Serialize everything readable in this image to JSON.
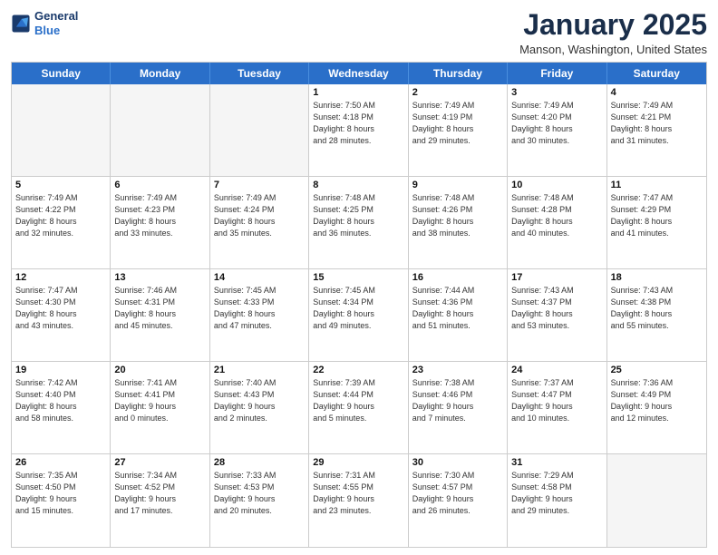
{
  "header": {
    "logo_line1": "General",
    "logo_line2": "Blue",
    "month_title": "January 2025",
    "location": "Manson, Washington, United States"
  },
  "weekdays": [
    "Sunday",
    "Monday",
    "Tuesday",
    "Wednesday",
    "Thursday",
    "Friday",
    "Saturday"
  ],
  "weeks": [
    [
      {
        "day": "",
        "info": "",
        "empty": true
      },
      {
        "day": "",
        "info": "",
        "empty": true
      },
      {
        "day": "",
        "info": "",
        "empty": true
      },
      {
        "day": "1",
        "info": "Sunrise: 7:50 AM\nSunset: 4:18 PM\nDaylight: 8 hours\nand 28 minutes.",
        "empty": false
      },
      {
        "day": "2",
        "info": "Sunrise: 7:49 AM\nSunset: 4:19 PM\nDaylight: 8 hours\nand 29 minutes.",
        "empty": false
      },
      {
        "day": "3",
        "info": "Sunrise: 7:49 AM\nSunset: 4:20 PM\nDaylight: 8 hours\nand 30 minutes.",
        "empty": false
      },
      {
        "day": "4",
        "info": "Sunrise: 7:49 AM\nSunset: 4:21 PM\nDaylight: 8 hours\nand 31 minutes.",
        "empty": false
      }
    ],
    [
      {
        "day": "5",
        "info": "Sunrise: 7:49 AM\nSunset: 4:22 PM\nDaylight: 8 hours\nand 32 minutes.",
        "empty": false
      },
      {
        "day": "6",
        "info": "Sunrise: 7:49 AM\nSunset: 4:23 PM\nDaylight: 8 hours\nand 33 minutes.",
        "empty": false
      },
      {
        "day": "7",
        "info": "Sunrise: 7:49 AM\nSunset: 4:24 PM\nDaylight: 8 hours\nand 35 minutes.",
        "empty": false
      },
      {
        "day": "8",
        "info": "Sunrise: 7:48 AM\nSunset: 4:25 PM\nDaylight: 8 hours\nand 36 minutes.",
        "empty": false
      },
      {
        "day": "9",
        "info": "Sunrise: 7:48 AM\nSunset: 4:26 PM\nDaylight: 8 hours\nand 38 minutes.",
        "empty": false
      },
      {
        "day": "10",
        "info": "Sunrise: 7:48 AM\nSunset: 4:28 PM\nDaylight: 8 hours\nand 40 minutes.",
        "empty": false
      },
      {
        "day": "11",
        "info": "Sunrise: 7:47 AM\nSunset: 4:29 PM\nDaylight: 8 hours\nand 41 minutes.",
        "empty": false
      }
    ],
    [
      {
        "day": "12",
        "info": "Sunrise: 7:47 AM\nSunset: 4:30 PM\nDaylight: 8 hours\nand 43 minutes.",
        "empty": false
      },
      {
        "day": "13",
        "info": "Sunrise: 7:46 AM\nSunset: 4:31 PM\nDaylight: 8 hours\nand 45 minutes.",
        "empty": false
      },
      {
        "day": "14",
        "info": "Sunrise: 7:45 AM\nSunset: 4:33 PM\nDaylight: 8 hours\nand 47 minutes.",
        "empty": false
      },
      {
        "day": "15",
        "info": "Sunrise: 7:45 AM\nSunset: 4:34 PM\nDaylight: 8 hours\nand 49 minutes.",
        "empty": false
      },
      {
        "day": "16",
        "info": "Sunrise: 7:44 AM\nSunset: 4:36 PM\nDaylight: 8 hours\nand 51 minutes.",
        "empty": false
      },
      {
        "day": "17",
        "info": "Sunrise: 7:43 AM\nSunset: 4:37 PM\nDaylight: 8 hours\nand 53 minutes.",
        "empty": false
      },
      {
        "day": "18",
        "info": "Sunrise: 7:43 AM\nSunset: 4:38 PM\nDaylight: 8 hours\nand 55 minutes.",
        "empty": false
      }
    ],
    [
      {
        "day": "19",
        "info": "Sunrise: 7:42 AM\nSunset: 4:40 PM\nDaylight: 8 hours\nand 58 minutes.",
        "empty": false
      },
      {
        "day": "20",
        "info": "Sunrise: 7:41 AM\nSunset: 4:41 PM\nDaylight: 9 hours\nand 0 minutes.",
        "empty": false
      },
      {
        "day": "21",
        "info": "Sunrise: 7:40 AM\nSunset: 4:43 PM\nDaylight: 9 hours\nand 2 minutes.",
        "empty": false
      },
      {
        "day": "22",
        "info": "Sunrise: 7:39 AM\nSunset: 4:44 PM\nDaylight: 9 hours\nand 5 minutes.",
        "empty": false
      },
      {
        "day": "23",
        "info": "Sunrise: 7:38 AM\nSunset: 4:46 PM\nDaylight: 9 hours\nand 7 minutes.",
        "empty": false
      },
      {
        "day": "24",
        "info": "Sunrise: 7:37 AM\nSunset: 4:47 PM\nDaylight: 9 hours\nand 10 minutes.",
        "empty": false
      },
      {
        "day": "25",
        "info": "Sunrise: 7:36 AM\nSunset: 4:49 PM\nDaylight: 9 hours\nand 12 minutes.",
        "empty": false
      }
    ],
    [
      {
        "day": "26",
        "info": "Sunrise: 7:35 AM\nSunset: 4:50 PM\nDaylight: 9 hours\nand 15 minutes.",
        "empty": false
      },
      {
        "day": "27",
        "info": "Sunrise: 7:34 AM\nSunset: 4:52 PM\nDaylight: 9 hours\nand 17 minutes.",
        "empty": false
      },
      {
        "day": "28",
        "info": "Sunrise: 7:33 AM\nSunset: 4:53 PM\nDaylight: 9 hours\nand 20 minutes.",
        "empty": false
      },
      {
        "day": "29",
        "info": "Sunrise: 7:31 AM\nSunset: 4:55 PM\nDaylight: 9 hours\nand 23 minutes.",
        "empty": false
      },
      {
        "day": "30",
        "info": "Sunrise: 7:30 AM\nSunset: 4:57 PM\nDaylight: 9 hours\nand 26 minutes.",
        "empty": false
      },
      {
        "day": "31",
        "info": "Sunrise: 7:29 AM\nSunset: 4:58 PM\nDaylight: 9 hours\nand 29 minutes.",
        "empty": false
      },
      {
        "day": "",
        "info": "",
        "empty": true
      }
    ]
  ]
}
